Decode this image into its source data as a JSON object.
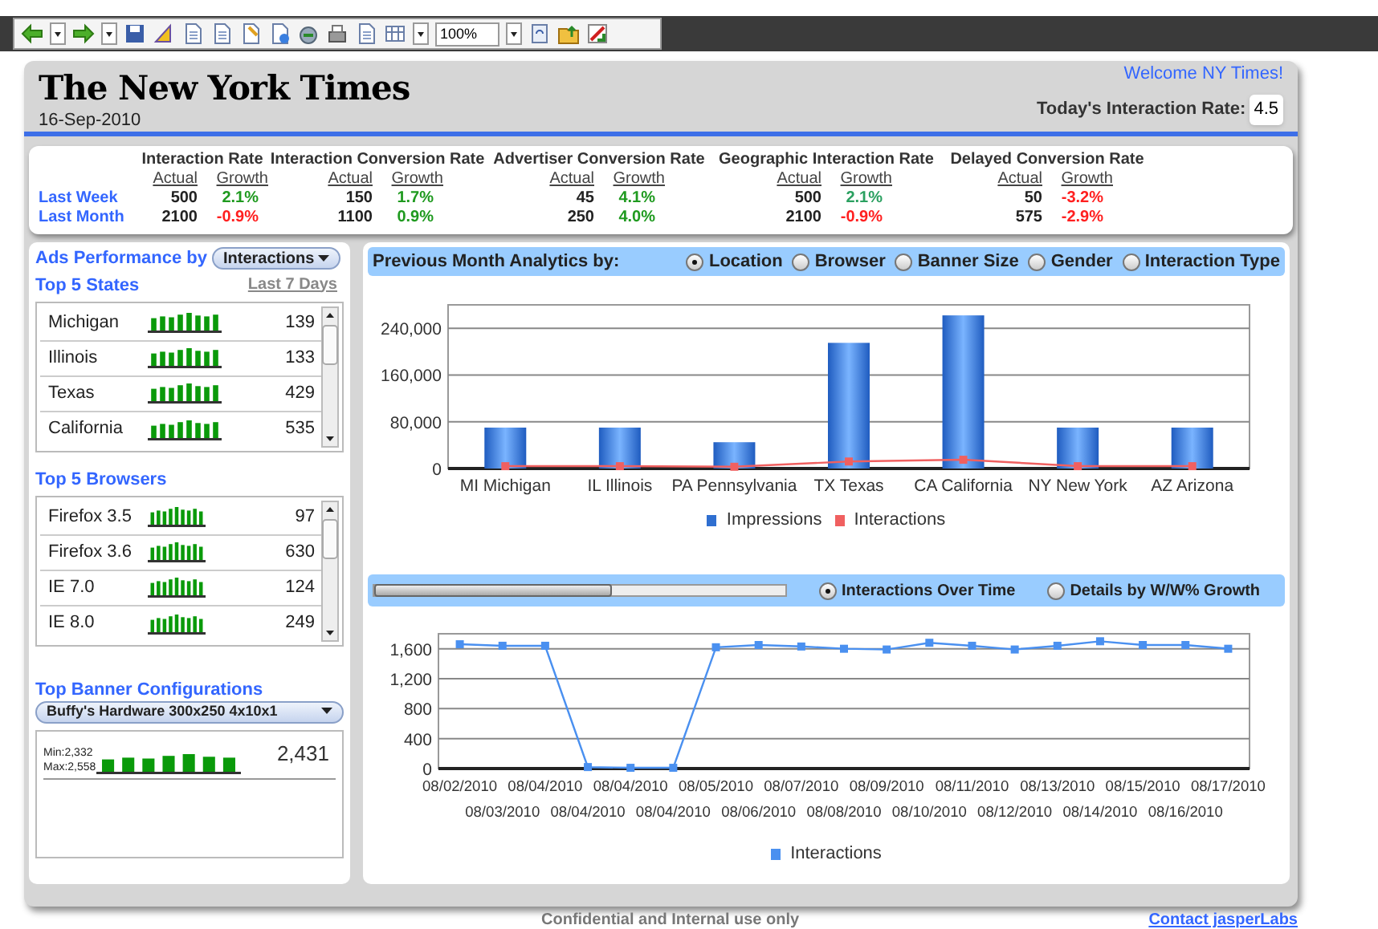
{
  "toolbar": {
    "zoom": "100%"
  },
  "header": {
    "logo": "The New York Times",
    "date": "16-Sep-2010",
    "welcome": "Welcome NY Times!",
    "rate_label": "Today's Interaction Rate:",
    "rate_value": "4.5"
  },
  "metrics": {
    "row_labels": [
      "Last Week",
      "Last Month"
    ],
    "groups": [
      {
        "title": "Interaction Rate",
        "columns": [
          "Actual",
          "Growth"
        ],
        "rows": [
          {
            "actual": "500",
            "growth": "2.1%",
            "color": "#1f9a1f"
          },
          {
            "actual": "2100",
            "growth": "-0.9%",
            "color": "#ff2020"
          }
        ]
      },
      {
        "title": "Interaction Conversion Rate",
        "columns": [
          "Actual",
          "Growth"
        ],
        "rows": [
          {
            "actual": "150",
            "growth": "1.7%",
            "color": "#1f9a1f"
          },
          {
            "actual": "1100",
            "growth": "0.9%",
            "color": "#1f9a1f"
          }
        ]
      },
      {
        "title": "Advertiser Conversion Rate",
        "columns": [
          "Actual",
          "Growth"
        ],
        "rows": [
          {
            "actual": "45",
            "growth": "4.1%",
            "color": "#1f9a1f"
          },
          {
            "actual": "250",
            "growth": "4.0%",
            "color": "#1f9a1f"
          }
        ]
      },
      {
        "title": "Geographic Interaction Rate",
        "columns": [
          "Actual",
          "Growth"
        ],
        "rows": [
          {
            "actual": "500",
            "growth": "2.1%",
            "color": "#2aa060"
          },
          {
            "actual": "2100",
            "growth": "-0.9%",
            "color": "#ff2020"
          }
        ]
      },
      {
        "title": "Delayed Conversion Rate",
        "columns": [
          "Actual",
          "Growth"
        ],
        "rows": [
          {
            "actual": "50",
            "growth": "-3.2%",
            "color": "#ff2020"
          },
          {
            "actual": "575",
            "growth": "-2.9%",
            "color": "#ff2020"
          }
        ]
      }
    ]
  },
  "ads_performance": {
    "label": "Ads Performance by",
    "dropdown": "Interactions",
    "period": "Last 7 Days",
    "sections": [
      {
        "title": "Top 5 States",
        "rows": [
          {
            "name": "Michigan",
            "value": "139"
          },
          {
            "name": "Illinois",
            "value": "133"
          },
          {
            "name": "Texas",
            "value": "429"
          },
          {
            "name": "California",
            "value": "535"
          }
        ]
      },
      {
        "title": "Top 5 Browsers",
        "rows": [
          {
            "name": "Firefox 3.5",
            "value": "97"
          },
          {
            "name": "Firefox 3.6",
            "value": "630"
          },
          {
            "name": "IE 7.0",
            "value": "124"
          },
          {
            "name": "IE 8.0",
            "value": "249"
          }
        ]
      }
    ],
    "banner": {
      "title": "Top Banner Configurations",
      "dropdown": "Buffy's Hardware 300x250 4x10x1",
      "min": "Min:2,332",
      "max": "Max:2,558",
      "value": "2,431"
    }
  },
  "analytics": {
    "title": "Previous Month Analytics by:",
    "options": [
      {
        "label": "Location",
        "selected": true
      },
      {
        "label": "Browser",
        "selected": false
      },
      {
        "label": "Banner Size",
        "selected": false
      },
      {
        "label": "Gender",
        "selected": false
      },
      {
        "label": "Interaction Type",
        "selected": false
      }
    ],
    "chart_data": {
      "type": "bar",
      "categories": [
        "MI Michigan",
        "IL Illinois",
        "PA Pennsylvania",
        "TX Texas",
        "CA California",
        "NY New York",
        "AZ Arizona"
      ],
      "grid": true,
      "series": [
        {
          "name": "Impressions",
          "type": "bar",
          "color": "#2f6fd0",
          "values": [
            70000,
            70000,
            45000,
            215000,
            262000,
            70000,
            70000
          ]
        },
        {
          "name": "Interactions",
          "type": "line",
          "marker": "square",
          "color": "#f06060",
          "values": [
            4000,
            4000,
            3000,
            12000,
            15000,
            4000,
            4000
          ]
        }
      ],
      "ylim": [
        0,
        280000
      ],
      "yticks": [
        {
          "value": 0,
          "label": "0"
        },
        {
          "value": 80000,
          "label": "80,000"
        },
        {
          "value": 160000,
          "label": "160,000"
        },
        {
          "value": 240000,
          "label": "240,000"
        }
      ]
    }
  },
  "timeline": {
    "slider": {
      "level": 0.58
    },
    "options": [
      {
        "label": "Interactions Over Time",
        "selected": true
      },
      {
        "label": "Details by W/W% Growth",
        "selected": false
      }
    ],
    "chart_data": {
      "type": "line",
      "categories": [
        "08/02/2010",
        "08/03/2010",
        "08/04/2010",
        "08/04/2010",
        "08/04/2010",
        "08/04/2010",
        "08/05/2010",
        "08/06/2010",
        "08/07/2010",
        "08/08/2010",
        "08/09/2010",
        "08/10/2010",
        "08/11/2010",
        "08/12/2010",
        "08/13/2010",
        "08/14/2010",
        "08/15/2010",
        "08/16/2010",
        "08/17/2010"
      ],
      "grid": true,
      "series": [
        {
          "name": "Interactions",
          "marker": "square",
          "color": "#4a90f0",
          "values": [
            1660,
            1640,
            1640,
            20,
            10,
            10,
            1620,
            1650,
            1630,
            1600,
            1590,
            1680,
            1640,
            1590,
            1640,
            1700,
            1650,
            1650,
            1600
          ]
        }
      ],
      "ylim": [
        0,
        1800
      ],
      "yticks": [
        {
          "value": 0,
          "label": "0"
        },
        {
          "value": 400,
          "label": "400"
        },
        {
          "value": 800,
          "label": "800"
        },
        {
          "value": 1200,
          "label": "1,200"
        },
        {
          "value": 1600,
          "label": "1,600"
        }
      ]
    }
  },
  "footer": {
    "note": "Confidential and Internal use only",
    "link": "Contact jasperLabs"
  }
}
